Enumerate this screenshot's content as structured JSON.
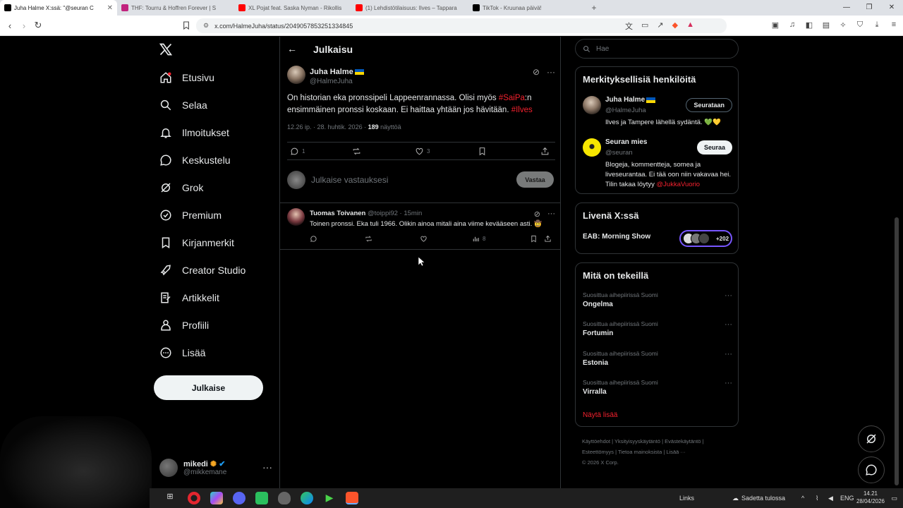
{
  "browser": {
    "tabs": [
      {
        "title": "Juha Halme X:ssä: \"@seuran C",
        "icon_color": "#000000",
        "active": true
      },
      {
        "title": "THF: Tourru & Hoffren Forever | S",
        "icon_color": "#c1237e",
        "active": false
      },
      {
        "title": "XL Pojat feat. Saska Nyman - Rikollis",
        "icon_color": "#ff0000",
        "active": false
      },
      {
        "title": "(1) Lehdistötilaisuus: Ilves – Tappara",
        "icon_color": "#ff0000",
        "active": false
      },
      {
        "title": "TikTok - Kruunaa päivä!",
        "icon_color": "#000000",
        "active": false
      }
    ],
    "url": "x.com/HalmeJuha/status/2049057853251334845"
  },
  "nav": {
    "items": [
      {
        "label": "Etusivu",
        "icon": "home-icon"
      },
      {
        "label": "Selaa",
        "icon": "search-icon"
      },
      {
        "label": "Ilmoitukset",
        "icon": "bell-icon"
      },
      {
        "label": "Keskustelu",
        "icon": "chat-icon"
      },
      {
        "label": "Grok",
        "icon": "grok-icon"
      },
      {
        "label": "Premium",
        "icon": "premium-icon"
      },
      {
        "label": "Kirjanmerkit",
        "icon": "bookmark-icon"
      },
      {
        "label": "Creator Studio",
        "icon": "rocket-icon"
      },
      {
        "label": "Artikkelit",
        "icon": "article-icon"
      },
      {
        "label": "Profiili",
        "icon": "person-icon"
      },
      {
        "label": "Lisää",
        "icon": "more-icon"
      }
    ],
    "post_button": "Julkaise",
    "me": {
      "name": "mikedi",
      "handle": "@mikkemane"
    }
  },
  "main": {
    "title": "Julkaisu",
    "post": {
      "author": "Juha Halme",
      "handle": "@HalmeJuha",
      "text_1": "On historian eka pronssipeli Lappeenrannassa. Olisi myös ",
      "hashtag_1": "#SaiPa",
      "text_2": ":n ensimmäinen pronssi koskaan. Ei haittaa yhtään jos hävitään. ",
      "hashtag_2": "#Ilves",
      "time": "12.26 ip. · 28. huhtik. 2026 · ",
      "views": "189",
      "views_label": " näyttöä",
      "replies": "1",
      "likes": "3"
    },
    "reply_placeholder": "Julkaise vastauksesi",
    "reply_button": "Vastaa",
    "comment": {
      "author": "Tuomas Toivanen",
      "meta": " @toippi92 · 15min",
      "text": "Toinen pronssi. Eka tuli 1966. Olikin ainoa mitali aina viime kevääseen asti. 🤠",
      "views": "8"
    }
  },
  "sidebar": {
    "search_placeholder": "Hae",
    "relevant_title": "Merkityksellisiä henkilöitä",
    "people": [
      {
        "name": "Juha Halme",
        "handle": "@HalmeJuha",
        "bio": "Ilves ja Tampere lähellä sydäntä. 💚💛",
        "bio_link": "",
        "button": "Seurataan"
      },
      {
        "name": "Seuran mies",
        "handle": "@seuran",
        "bio": "Blogeja, kommentteja, somea ja liveseurantaa. Ei tää oon niin vakavaa hei. Tilin takaa löytyy ",
        "bio_link": "@JukkaVuorio",
        "button": "Seuraa"
      }
    ],
    "live_title": "Livenä X:ssä",
    "live_show": "EAB: Morning Show",
    "live_count": "+202",
    "trends_title": "Mitä on tekeillä",
    "trends": [
      {
        "context": "Suosittua aihepiirissä Suomi",
        "name": "Ongelma"
      },
      {
        "context": "Suosittua aihepiirissä Suomi",
        "name": "Fortumin"
      },
      {
        "context": "Suosittua aihepiirissä Suomi",
        "name": "Estonia"
      },
      {
        "context": "Suosittua aihepiirissä Suomi",
        "name": "Virralla"
      }
    ],
    "show_more": "Näytä lisää",
    "footer_1": "Käyttöehdot  |  Yksityisyyskäytäntö  |  Evästekäytäntö  |",
    "footer_2": "Esteettömyys  |  Tietoa mainoksista  |  Lisää ···",
    "footer_3": "© 2026 X Corp."
  },
  "taskbar": {
    "links": "Links",
    "weather": "Sadetta tulossa",
    "lang": "ENG",
    "time": "14.21",
    "date": "28/04/2026"
  }
}
